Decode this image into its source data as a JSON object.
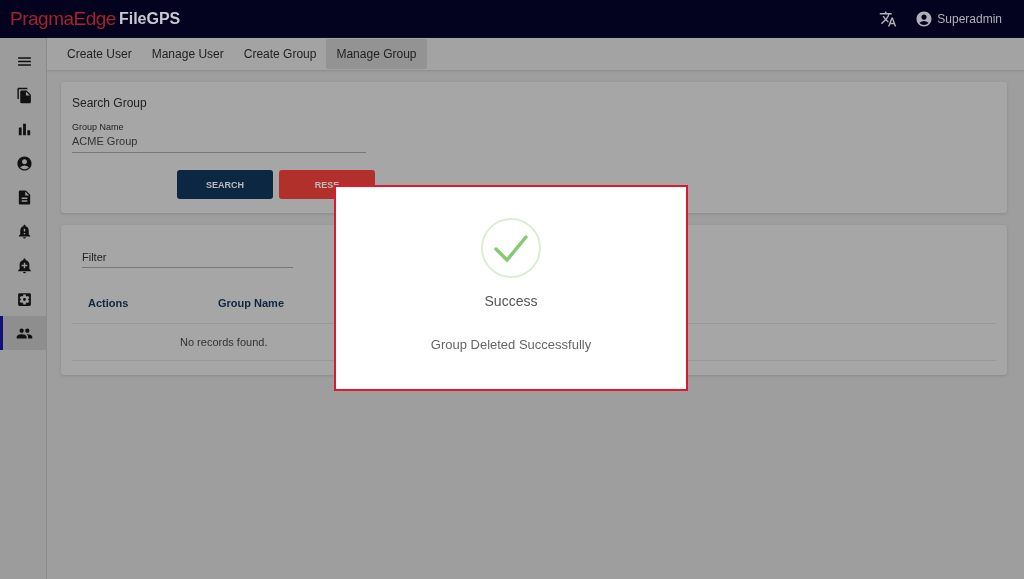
{
  "header": {
    "brand": "PragmaEdge",
    "product": "FileGPS",
    "user": "Superadmin"
  },
  "sidebar": {
    "items": [
      {
        "kind": "menu",
        "selected": false
      },
      {
        "kind": "files",
        "selected": false
      },
      {
        "kind": "chart",
        "selected": false
      },
      {
        "kind": "account",
        "selected": false
      },
      {
        "kind": "document",
        "selected": false
      },
      {
        "kind": "alert",
        "selected": false
      },
      {
        "kind": "add-alert",
        "selected": false
      },
      {
        "kind": "settings",
        "selected": false
      },
      {
        "kind": "people",
        "selected": true
      }
    ]
  },
  "tabs": [
    {
      "label": "Create User",
      "selected": false
    },
    {
      "label": "Manage User",
      "selected": false
    },
    {
      "label": "Create Group",
      "selected": false
    },
    {
      "label": "Manage Group",
      "selected": true
    }
  ],
  "search_card": {
    "title": "Search Group",
    "field": {
      "label": "Group Name",
      "value": "ACME Group"
    },
    "buttons": [
      {
        "kind": "primary",
        "label": "SEARCH"
      },
      {
        "kind": "danger",
        "label": "RESE"
      }
    ]
  },
  "results_card": {
    "filter": {
      "placeholder": "Filter"
    },
    "table": {
      "columns": [
        "Actions",
        "Group Name"
      ],
      "empty_message": "No records found."
    }
  },
  "dialog": {
    "title": "Success",
    "message": "Group Deleted Successfully"
  }
}
